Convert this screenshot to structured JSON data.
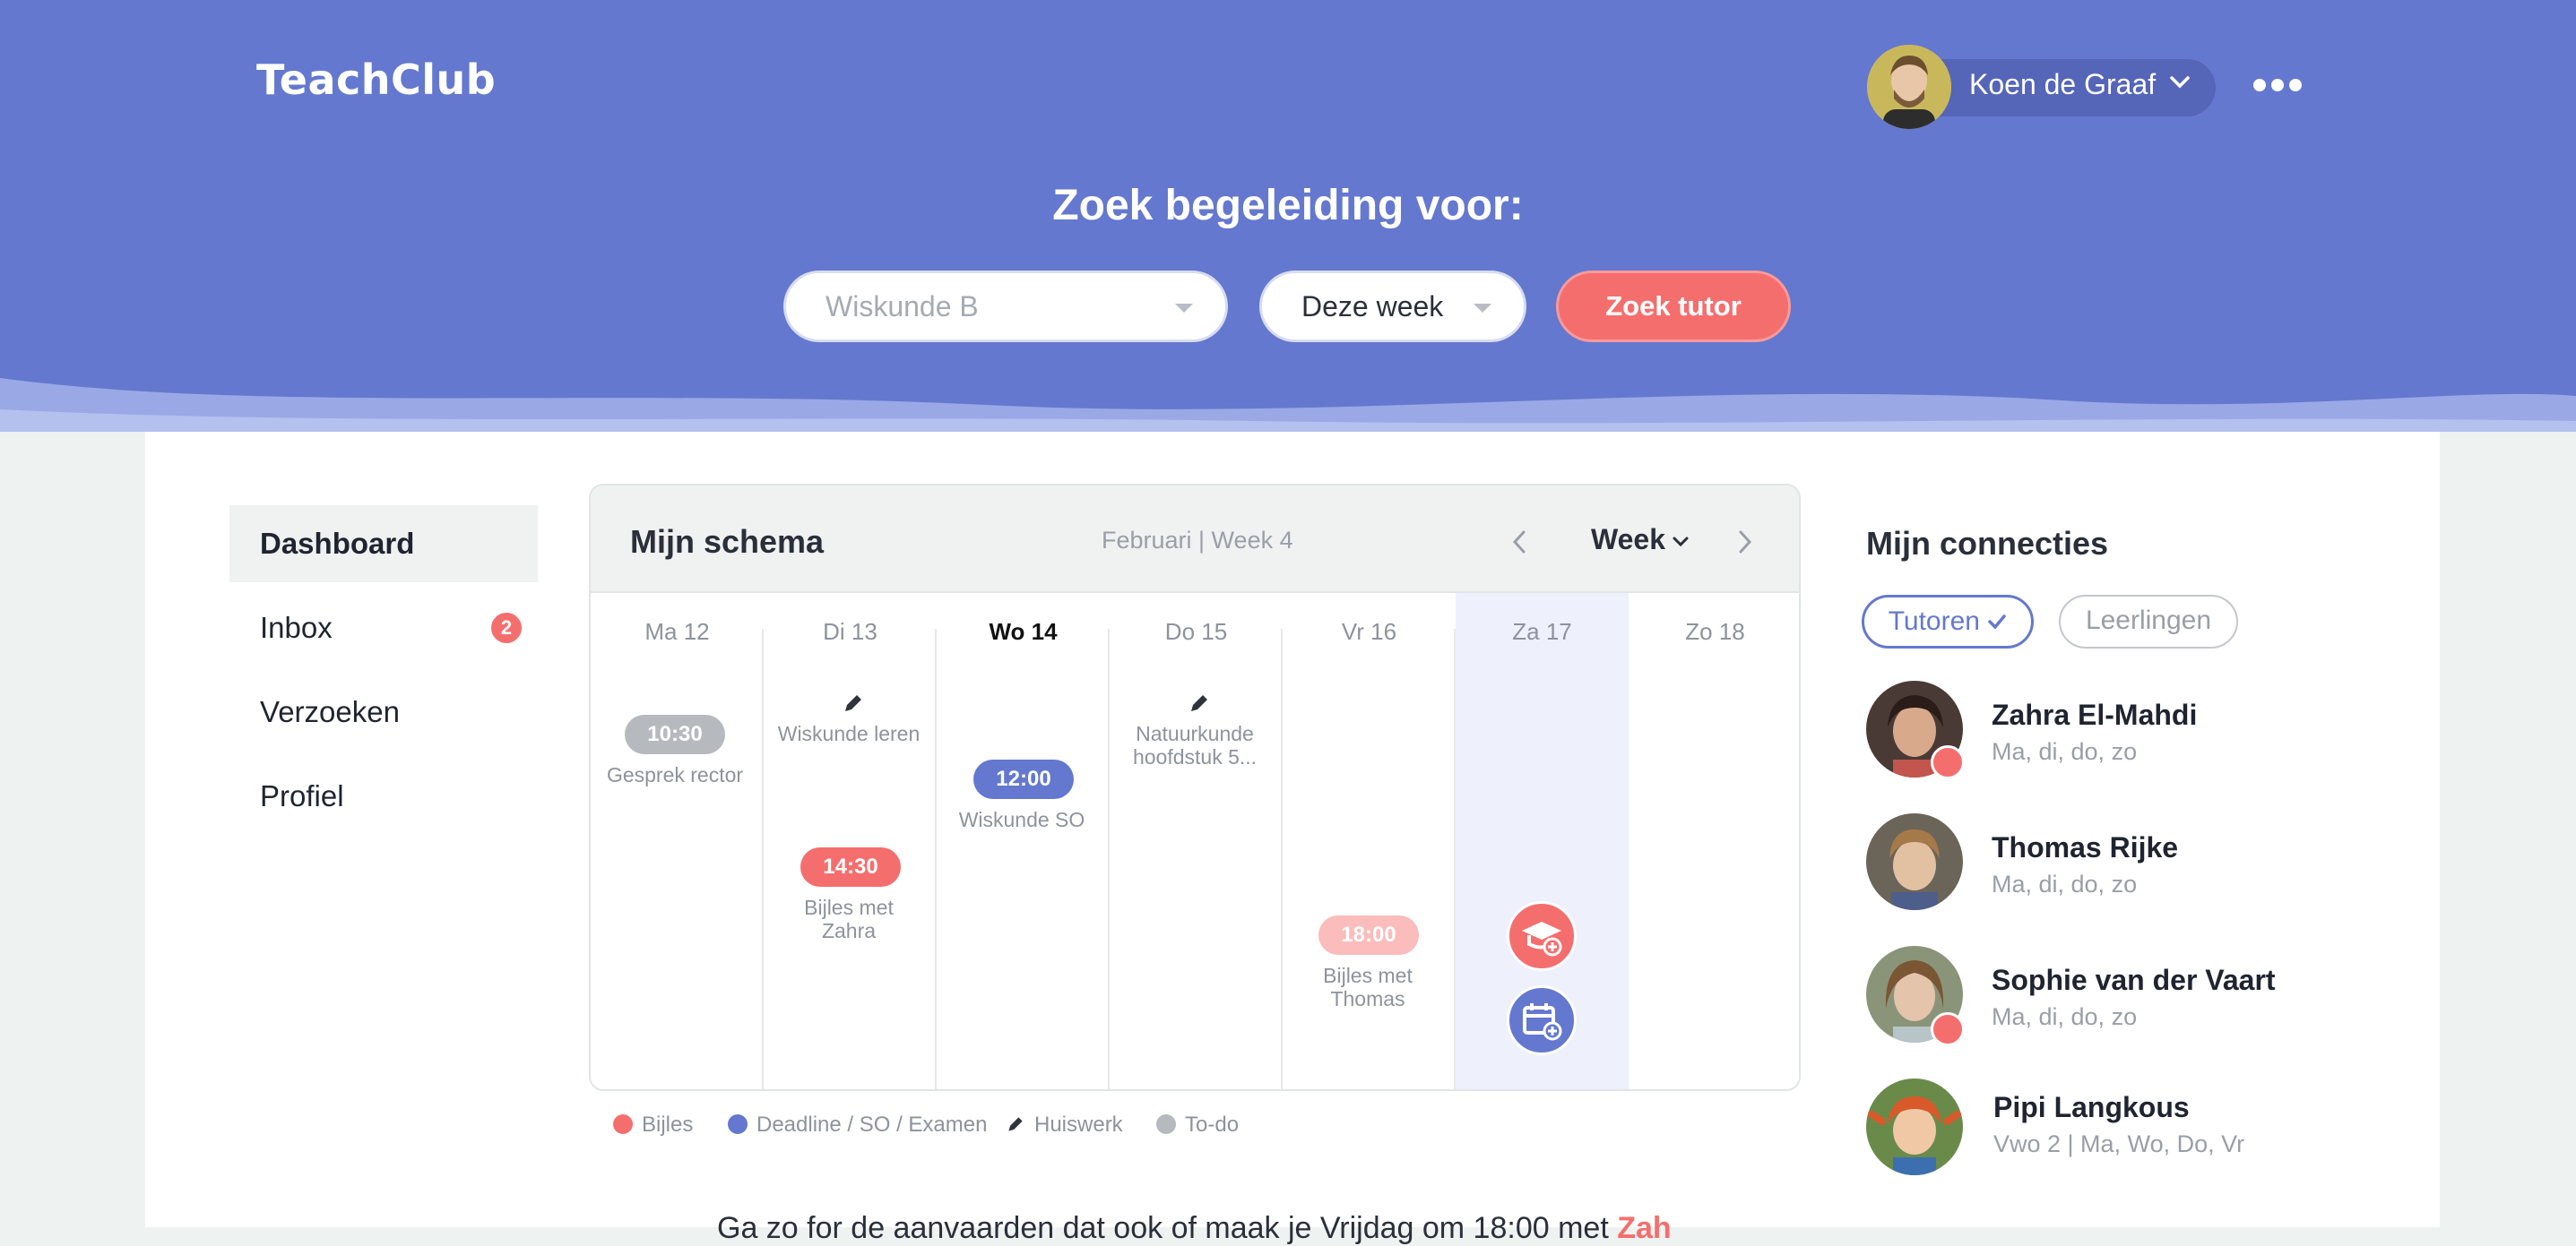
{
  "header": {
    "logo": "TeachClub",
    "user_name": "Koen de Graaf",
    "search_title": "Zoek begeleiding voor:",
    "subject_placeholder": "Wiskunde B",
    "period_value": "Deze week",
    "search_button": "Zoek tutor"
  },
  "sidebar": {
    "items": [
      {
        "label": "Dashboard",
        "active": true
      },
      {
        "label": "Inbox",
        "badge": "2"
      },
      {
        "label": "Verzoeken"
      },
      {
        "label": "Profiel"
      }
    ]
  },
  "schedule": {
    "title": "Mijn schema",
    "period": "Februari | Week 4",
    "view": "Week",
    "days": [
      {
        "label": "Ma 12"
      },
      {
        "label": "Di 13"
      },
      {
        "label": "Wo 14",
        "today": true
      },
      {
        "label": "Do 15"
      },
      {
        "label": "Vr 16"
      },
      {
        "label": "Za 17"
      },
      {
        "label": "Zo 18"
      }
    ],
    "events": {
      "ma_time": "10:30",
      "ma_label": "Gesprek rector",
      "di_hw_label": "Wiskunde leren",
      "di_time": "14:30",
      "di_label_1": "Bijles met",
      "di_label_2": "Zahra",
      "wo_time": "12:00",
      "wo_label": "Wiskunde SO",
      "do_hw_label_1": "Natuurkunde",
      "do_hw_label_2": "hoofdstuk 5...",
      "vr_time": "18:00",
      "vr_label_1": "Bijles met",
      "vr_label_2": "Thomas"
    },
    "legend": [
      {
        "label": "Bijles",
        "color": "#f56e6e"
      },
      {
        "label": "Deadline / SO / Examen",
        "color": "#6478cf"
      },
      {
        "label": "Huiswerk",
        "color": "#555a63"
      },
      {
        "label": "To-do",
        "color": "#b6b9be"
      }
    ]
  },
  "connections": {
    "title": "Mijn connecties",
    "tabs": [
      "Tutoren",
      "Leerlingen"
    ],
    "people": [
      {
        "name": "Zahra El-Mahdi",
        "sub": "Ma, di, do, zo"
      },
      {
        "name": "Thomas Rijke",
        "sub": "Ma, di, do, zo"
      },
      {
        "name": "Sophie van der Vaart",
        "sub": "Ma, di, do, zo"
      },
      {
        "name": "Pipi Langkous",
        "sub": "Vwo 2 | Ma, Wo, Do, Vr"
      }
    ]
  },
  "bottom": {
    "text": "Ga zo for de aanvaarden dat ook of maak je Vrijdag om 18:00 met",
    "highlight": "Zah"
  },
  "colors": {
    "brand": "#6478cf",
    "accent": "#f56e6e",
    "todo": "#b6b9be"
  }
}
